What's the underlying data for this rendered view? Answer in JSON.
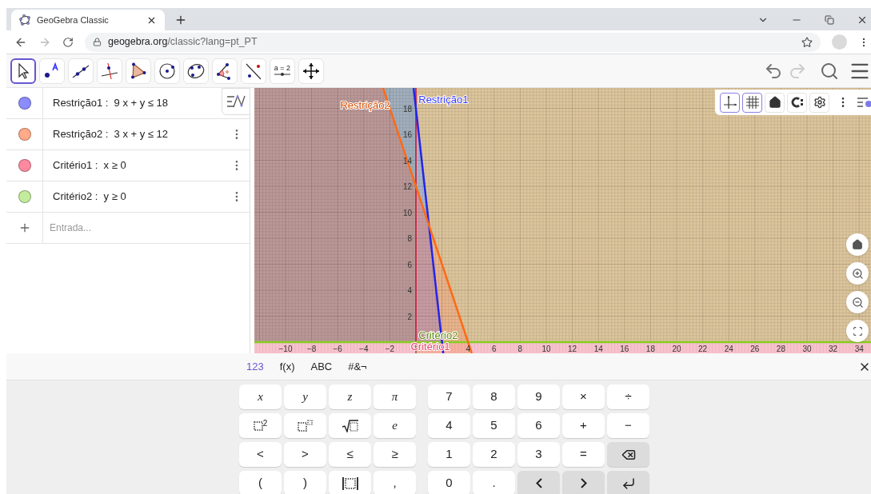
{
  "browser": {
    "tab_title": "GeoGebra Classic",
    "url_host": "geogebra.org",
    "url_path": "/classic?lang=pt_PT"
  },
  "toolbar": {
    "tools": [
      {
        "kind": "move",
        "selected": true
      },
      {
        "kind": "point",
        "selected": false
      },
      {
        "kind": "line",
        "selected": false
      },
      {
        "kind": "perpendicular",
        "selected": false
      },
      {
        "kind": "polygon",
        "selected": false
      },
      {
        "kind": "circle",
        "selected": false
      },
      {
        "kind": "conic",
        "selected": false
      },
      {
        "kind": "angle",
        "selected": false
      },
      {
        "kind": "reflect",
        "selected": false
      },
      {
        "kind": "slider",
        "selected": false,
        "label": "a = 2"
      },
      {
        "kind": "move_view",
        "selected": false
      }
    ],
    "undo": {
      "disabled": false
    },
    "redo": {
      "disabled": true
    }
  },
  "algebra": {
    "items": [
      {
        "text": "Restrição1 :  9 x + y ≤ 18",
        "color": "#8c8cff",
        "menu": false
      },
      {
        "text": "Restrição2 :  3 x + y ≤ 12",
        "color": "#ffaa88",
        "menu": true
      },
      {
        "text": "Critério1 :  x ≥ 0",
        "color": "#ff8aa0",
        "menu": true
      },
      {
        "text": "Critério2 :  y ≥ 0",
        "color": "#c2ec9c",
        "menu": true
      }
    ],
    "input": {
      "placeholder": "Entrada..."
    }
  },
  "graph": {
    "axes_on": true,
    "grid_on": true,
    "x_labels": [
      "−10",
      "−8",
      "−6",
      "−4",
      "−2",
      "4",
      "6",
      "8",
      "10",
      "12",
      "14",
      "16",
      "18",
      "20",
      "22",
      "24",
      "26",
      "28",
      "30",
      "32",
      "34"
    ],
    "y_labels": [
      "18",
      "16",
      "14",
      "12",
      "10",
      "8",
      "6",
      "4",
      "2"
    ],
    "curve_labels": [
      {
        "text": "Restrição2",
        "color": "#d84f00"
      },
      {
        "text": "Restrição1",
        "color": "#3a3aff"
      },
      {
        "text": "Critério2",
        "color": "#5f8c0a"
      },
      {
        "text": "Critério1",
        "color": "#e8406e"
      }
    ]
  },
  "keyboard": {
    "tabs": [
      {
        "label": "123",
        "selected": true
      },
      {
        "label": "f(x)",
        "selected": false
      },
      {
        "label": "ABC",
        "selected": false
      },
      {
        "label": "#&¬",
        "selected": false
      }
    ],
    "left_keys": [
      [
        {
          "kind": "var",
          "label": "x"
        },
        {
          "kind": "var",
          "label": "y"
        },
        {
          "kind": "var",
          "label": "z"
        },
        {
          "kind": "var",
          "label": "π"
        }
      ],
      [
        {
          "kind": "square",
          "label": "2"
        },
        {
          "kind": "power"
        },
        {
          "kind": "sqrt"
        },
        {
          "kind": "var",
          "label": "e"
        }
      ],
      [
        {
          "kind": "text",
          "label": "<"
        },
        {
          "kind": "text",
          "label": ">"
        },
        {
          "kind": "text",
          "label": "≤"
        },
        {
          "kind": "text",
          "label": "≥"
        }
      ],
      [
        {
          "kind": "text",
          "label": "("
        },
        {
          "kind": "text",
          "label": ")"
        },
        {
          "kind": "abs"
        },
        {
          "kind": "text",
          "label": ","
        }
      ]
    ],
    "right_keys": [
      [
        {
          "kind": "text",
          "label": "7"
        },
        {
          "kind": "text",
          "label": "8"
        },
        {
          "kind": "text",
          "label": "9"
        },
        {
          "kind": "text",
          "label": "×"
        },
        {
          "kind": "text",
          "label": "÷"
        }
      ],
      [
        {
          "kind": "text",
          "label": "4"
        },
        {
          "kind": "text",
          "label": "5"
        },
        {
          "kind": "text",
          "label": "6"
        },
        {
          "kind": "text",
          "label": "+"
        },
        {
          "kind": "text",
          "label": "−"
        }
      ],
      [
        {
          "kind": "text",
          "label": "1"
        },
        {
          "kind": "text",
          "label": "2"
        },
        {
          "kind": "text",
          "label": "3"
        },
        {
          "kind": "text",
          "label": "="
        },
        {
          "kind": "backspace"
        }
      ],
      [
        {
          "kind": "text",
          "label": "0"
        },
        {
          "kind": "text",
          "label": "."
        },
        {
          "kind": "left"
        },
        {
          "kind": "right"
        },
        {
          "kind": "enter"
        }
      ]
    ]
  }
}
